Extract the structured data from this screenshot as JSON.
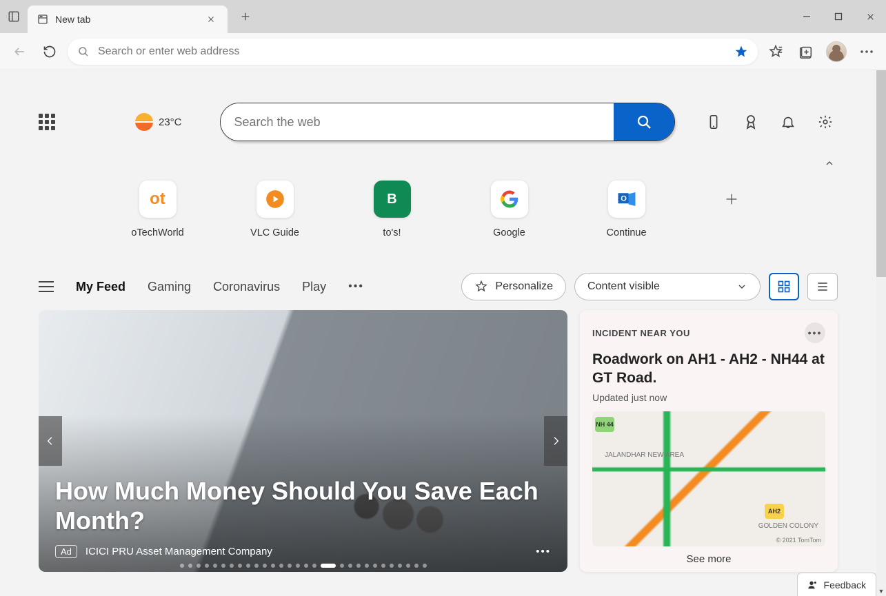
{
  "window": {
    "tab_title": "New tab"
  },
  "address_bar": {
    "placeholder": "Search or enter web address"
  },
  "weather": {
    "temperature": "23°C"
  },
  "search": {
    "placeholder": "Search the web"
  },
  "quick_links": [
    {
      "label": "oTechWorld",
      "icon_color": "#f28b20",
      "letter": "ot"
    },
    {
      "label": "VLC Guide",
      "icon_color": "#f28b20",
      "letter": "▶"
    },
    {
      "label": "to's!",
      "icon_color": "#0f8a55",
      "letter": "B"
    },
    {
      "label": "Google",
      "icon_color": "#fff",
      "letter": "G"
    },
    {
      "label": "Continue",
      "icon_color": "#fff",
      "letter": "O"
    }
  ],
  "feed_tabs": [
    "My Feed",
    "Gaming",
    "Coronavirus",
    "Play"
  ],
  "personalize": {
    "label": "Personalize"
  },
  "content_dropdown": {
    "label": "Content visible"
  },
  "hero": {
    "headline": "How Much Money Should You Save Each Month?",
    "ad_label": "Ad",
    "source": "ICICI PRU Asset Management Company",
    "dots_total": 29,
    "dots_active": 17
  },
  "incident": {
    "eyebrow": "INCIDENT NEAR YOU",
    "title": "Roadwork on AH1 - AH2 - NH44 at GT Road.",
    "updated": "Updated just now",
    "map_area1": "JALANDHAR NEW AREA",
    "map_area2": "GOLDEN COLONY",
    "map_shield1": "NH 44",
    "map_shield2": "AH2",
    "map_attrib": "© 2021 TomTom",
    "see_more": "See more"
  },
  "feedback": {
    "label": "Feedback"
  }
}
